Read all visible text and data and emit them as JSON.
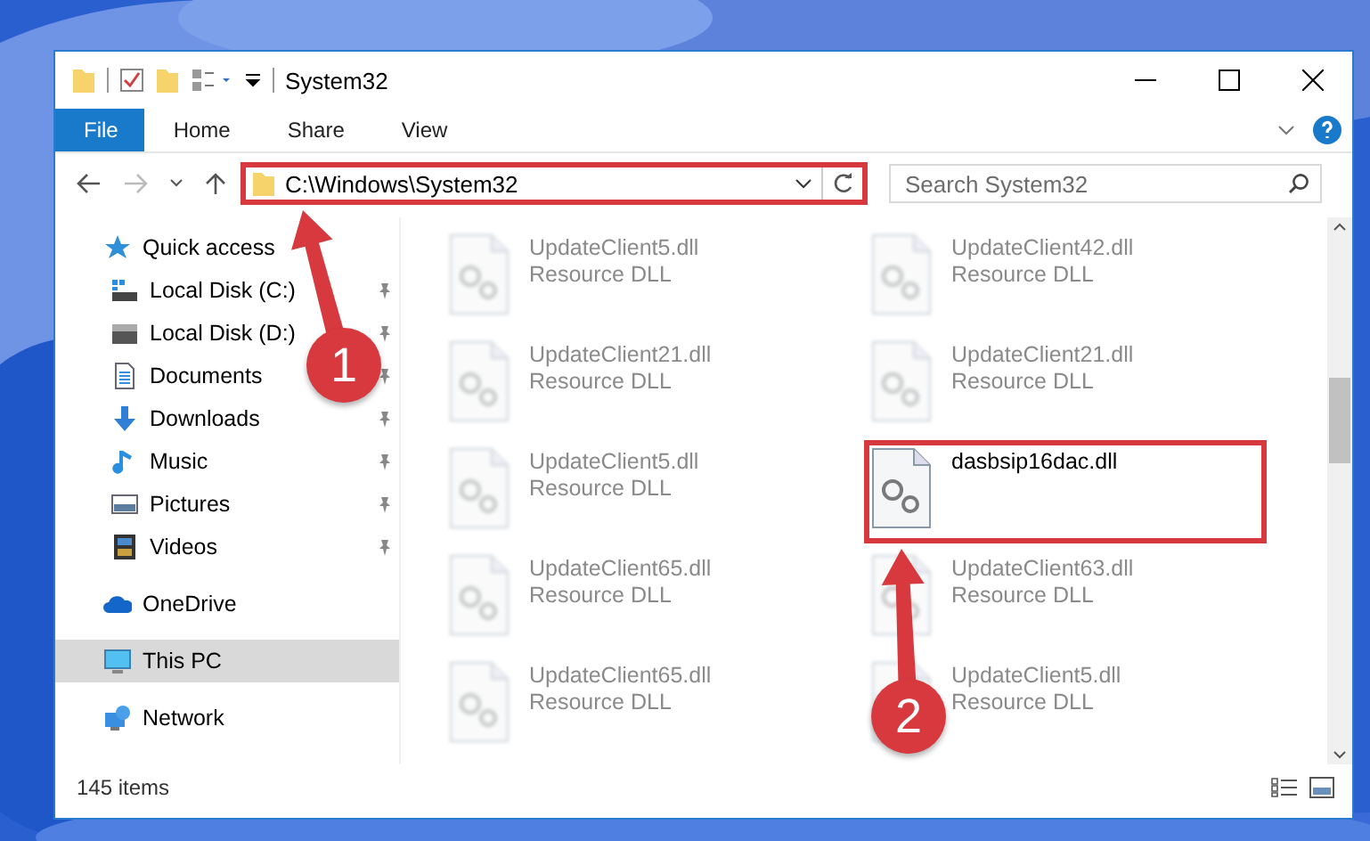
{
  "window": {
    "title": "System32"
  },
  "ribbon": {
    "tabs": [
      {
        "label": "File",
        "kind": "file",
        "selected": false
      },
      {
        "label": "Home",
        "kind": "tab",
        "selected": false
      },
      {
        "label": "Share",
        "kind": "tab",
        "selected": false
      },
      {
        "label": "View",
        "kind": "tab",
        "selected": false
      }
    ]
  },
  "address": {
    "path": "C:\\Windows\\System32",
    "highlighted": true,
    "search": {
      "placeholder": "Search System32"
    }
  },
  "sidebar": {
    "items": [
      {
        "label": "Quick access",
        "selected": false,
        "children": [
          {
            "label": "Local Disk (C:)",
            "pinned": true,
            "selected": false
          },
          {
            "label": "Local Disk (D:)",
            "pinned": true,
            "selected": false
          },
          {
            "label": "Documents",
            "pinned": true,
            "selected": false
          },
          {
            "label": "Downloads",
            "pinned": true,
            "selected": false
          },
          {
            "label": "Music",
            "pinned": true,
            "selected": false
          },
          {
            "label": "Pictures",
            "pinned": true,
            "selected": false
          },
          {
            "label": "Videos",
            "pinned": true,
            "selected": false
          }
        ]
      },
      {
        "label": "OneDrive",
        "selected": false
      },
      {
        "label": "This PC",
        "selected": true
      },
      {
        "label": "Network",
        "selected": false
      }
    ]
  },
  "files": [
    {
      "name": "UpdateClient5.dll",
      "type": "Resource DLL",
      "blurred": true,
      "highlighted": false
    },
    {
      "name": "UpdateClient42.dll",
      "type": "Resource DLL",
      "blurred": true,
      "highlighted": false
    },
    {
      "name": "UpdateClient21.dll",
      "type": "Resource DLL",
      "blurred": true,
      "highlighted": false
    },
    {
      "name": "UpdateClient21.dll",
      "type": "Resource DLL",
      "blurred": true,
      "highlighted": false
    },
    {
      "name": "UpdateClient5.dll",
      "type": "Resource DLL",
      "blurred": true,
      "highlighted": false
    },
    {
      "name": "dasbsip16dac.dll",
      "blurred": false,
      "highlighted": true
    },
    {
      "name": "UpdateClient65.dll",
      "type": "Resource DLL",
      "blurred": true,
      "highlighted": false
    },
    {
      "name": "UpdateClient63.dll",
      "type": "Resource DLL",
      "blurred": true,
      "highlighted": false
    },
    {
      "name": "UpdateClient65.dll",
      "type": "Resource DLL",
      "blurred": true,
      "highlighted": false
    },
    {
      "name": "UpdateClient5.dll",
      "type": "Resource DLL",
      "blurred": true,
      "highlighted": false
    }
  ],
  "status_bar": {
    "count": "145 items"
  },
  "callouts": [
    {
      "number": "1"
    },
    {
      "number": "2"
    }
  ]
}
